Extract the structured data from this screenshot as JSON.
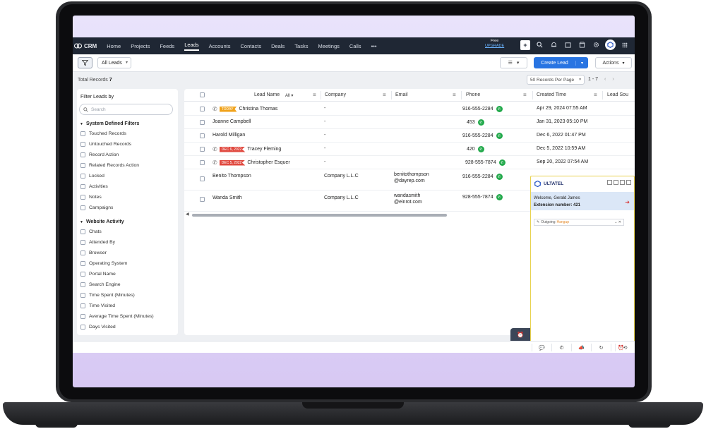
{
  "nav": {
    "app_name": "CRM",
    "items": [
      "Home",
      "Projects",
      "Feeds",
      "Leads",
      "Accounts",
      "Contacts",
      "Deals",
      "Tasks",
      "Meetings",
      "Calls"
    ],
    "active": "Leads",
    "more": "•••",
    "upgrade_top": "Free",
    "upgrade_link": "UPGRADE"
  },
  "toolbar": {
    "view_selector": "All Leads",
    "create_lead": "Create Lead",
    "actions": "Actions"
  },
  "subbar": {
    "total_label": "Total Records",
    "total_count": "7",
    "per_page": "50 Records Per Page",
    "range": "1 - 7"
  },
  "sidebar": {
    "title": "Filter Leads by",
    "search_placeholder": "Search",
    "group1": "System Defined Filters",
    "group1_items": [
      "Touched Records",
      "Untouched Records",
      "Record Action",
      "Related Records Action",
      "Locked",
      "Activities",
      "Notes",
      "Campaigns"
    ],
    "group2": "Website Activity",
    "group2_items": [
      "Chats",
      "Attended By",
      "Browser",
      "Operating System",
      "Portal Name",
      "Search Engine",
      "Time Spent (Minutes)",
      "Time Visited",
      "Average Time Spent (Minutes)",
      "Days Visited"
    ]
  },
  "grid": {
    "columns": {
      "lead_name": "Lead Name",
      "filter_all": "All",
      "company": "Company",
      "email": "Email",
      "phone": "Phone",
      "created_time": "Created Time",
      "lead_source": "Lead Sou"
    },
    "rows": [
      {
        "name": "Christina Thomas",
        "badge": "TODAY",
        "company": "-",
        "email1": "",
        "email2": "",
        "phone": "916-555-2284",
        "created": "Apr 29, 2024 07:55 AM"
      },
      {
        "name": "Joanne Campbell",
        "badge": "",
        "company": "-",
        "email1": "",
        "email2": "",
        "phone": "453",
        "created": "Jan 31, 2023 05:10 PM"
      },
      {
        "name": "Harold Milligan",
        "badge": "",
        "company": "-",
        "email1": "",
        "email2": "",
        "phone": "916-555-2284",
        "created": "Dec 6, 2022 01:47 PM"
      },
      {
        "name": "Tracey Fleming",
        "badge": "DEC 6, 2022",
        "company": "-",
        "email1": "",
        "email2": "",
        "phone": "420",
        "created": "Dec 5, 2022 10:59 AM"
      },
      {
        "name": "Christopher Esquer",
        "badge": "DEC 5, 2022",
        "company": "-",
        "email1": "",
        "email2": "",
        "phone": "928-555-7874",
        "created": "Sep 20, 2022 07:54 AM"
      },
      {
        "name": "Benito Thompson",
        "badge": "",
        "company": "Company L.L.C",
        "email1": "benitothompson",
        "email2": "@dayrep.com",
        "phone": "916-555-2284",
        "created": ""
      },
      {
        "name": "Wanda Smith",
        "badge": "",
        "company": "Company L.L.C",
        "email1": "wandasmith",
        "email2": "@einrot.com",
        "phone": "928-555-7874",
        "created": ""
      }
    ]
  },
  "phone_widget": {
    "brand": "ULTATEL",
    "welcome": "Welcome,",
    "user": "Gerald James",
    "extension": "Extension number: 421",
    "outgoing": "Outgoing",
    "hangup": "Hangup"
  },
  "colors": {
    "nav_bg": "#1f2734",
    "primary": "#2874e2",
    "today_badge": "#f0a31c",
    "date_badge": "#e0493f",
    "call_green": "#22a94b"
  }
}
